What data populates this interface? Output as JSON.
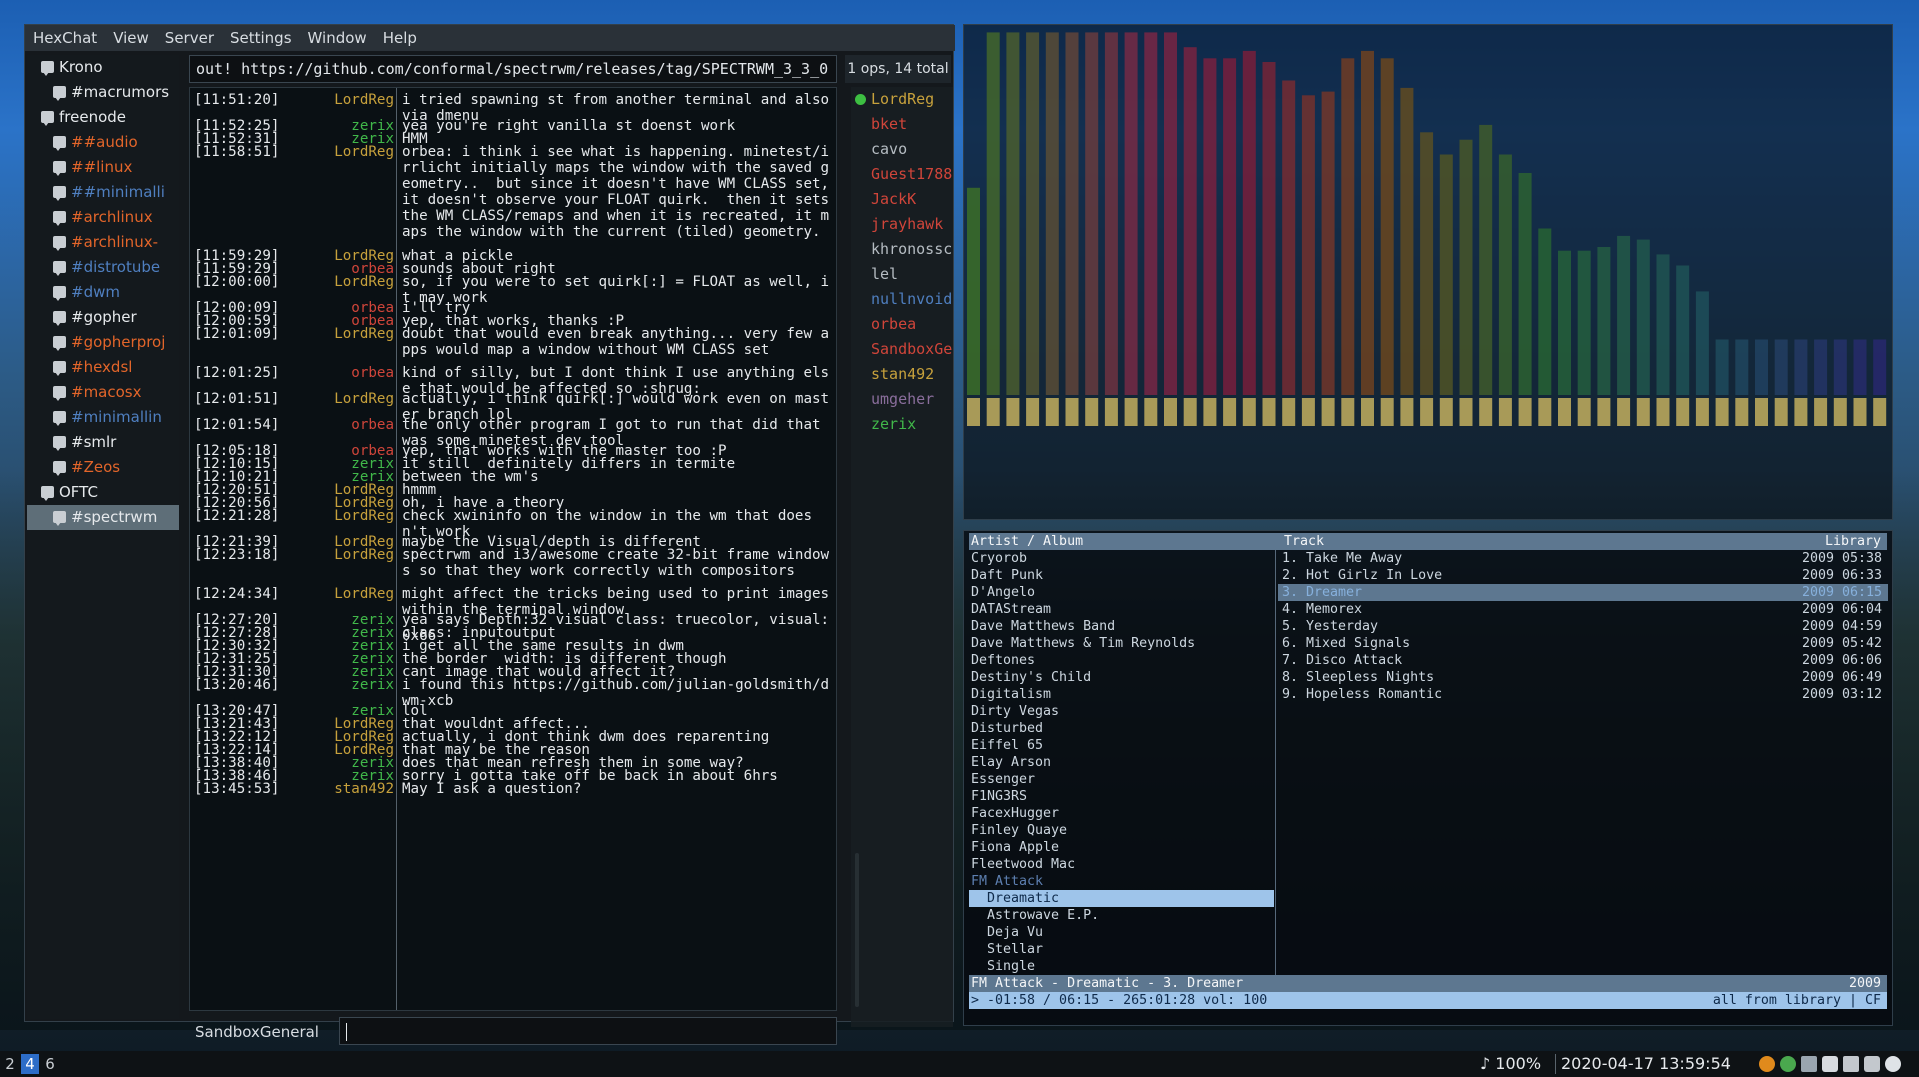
{
  "hexchat": {
    "menu": [
      "HexChat",
      "View",
      "Server",
      "Settings",
      "Window",
      "Help"
    ],
    "tree": [
      {
        "label": "Krono",
        "kind": "server",
        "color": "#e6e9ec"
      },
      {
        "label": "#macrumors",
        "kind": "channel",
        "color": "#e6e9ec"
      },
      {
        "label": "freenode",
        "kind": "server",
        "color": "#e6e9ec"
      },
      {
        "label": "##audio",
        "kind": "channel",
        "color": "#e2652a"
      },
      {
        "label": "##linux",
        "kind": "channel",
        "color": "#e2652a"
      },
      {
        "label": "##minimalli",
        "kind": "channel",
        "color": "#4f7fc0"
      },
      {
        "label": "#archlinux",
        "kind": "channel",
        "color": "#e2652a"
      },
      {
        "label": "#archlinux-",
        "kind": "channel",
        "color": "#e2652a"
      },
      {
        "label": "#distrotube",
        "kind": "channel",
        "color": "#4f7fc0"
      },
      {
        "label": "#dwm",
        "kind": "channel",
        "color": "#4f7fc0"
      },
      {
        "label": "#gopher",
        "kind": "channel",
        "color": "#e6e9ec"
      },
      {
        "label": "#gopherproj",
        "kind": "channel",
        "color": "#e2652a"
      },
      {
        "label": "#hexdsl",
        "kind": "channel",
        "color": "#e2652a"
      },
      {
        "label": "#macosx",
        "kind": "channel",
        "color": "#e2652a"
      },
      {
        "label": "#minimallin",
        "kind": "channel",
        "color": "#4f7fc0"
      },
      {
        "label": "#smlr",
        "kind": "channel",
        "color": "#e6e9ec"
      },
      {
        "label": "#Zeos",
        "kind": "channel",
        "color": "#e2652a"
      },
      {
        "label": "OFTC",
        "kind": "server",
        "color": "#e6e9ec"
      },
      {
        "label": "#spectrwm",
        "kind": "channel",
        "color": "#e6e9ec",
        "selected": true
      }
    ],
    "topic": "out! https://github.com/conformal/spectrwm/releases/tag/SPECTRWM_3_3_0",
    "user_count": "1 ops, 14 total",
    "messages": [
      {
        "ts": "[11:51:20]",
        "nick": "LordReg",
        "text": "i tried spawning st from another terminal and also via dmenu"
      },
      {
        "ts": "[11:52:25]",
        "nick": "zerix",
        "text": "yea you're right vanilla st doenst work"
      },
      {
        "ts": "[11:52:31]",
        "nick": "zerix",
        "text": "HMM"
      },
      {
        "ts": "[11:58:51]",
        "nick": "LordReg",
        "text": "orbea: i think i see what is happening. minetest/irrlicht initially maps the window with the saved geometry..  but since it doesn't have WM CLASS set, it doesn't observe your FLOAT quirk.  then it sets the WM CLASS/remaps and when it is recreated, it maps the window with the current (tiled) geometry."
      },
      {
        "ts": "[11:59:29]",
        "nick": "LordReg",
        "text": "what a pickle"
      },
      {
        "ts": "[11:59:29]",
        "nick": "orbea",
        "text": "sounds about right"
      },
      {
        "ts": "[12:00:00]",
        "nick": "LordReg",
        "text": "so, if you were to set quirk[:] = FLOAT as well, it may work"
      },
      {
        "ts": "[12:00:09]",
        "nick": "orbea",
        "text": "i'll try"
      },
      {
        "ts": "[12:00:59]",
        "nick": "orbea",
        "text": "yep, that works, thanks :P"
      },
      {
        "ts": "[12:01:09]",
        "nick": "LordReg",
        "text": "doubt that would even break anything... very few apps would map a window without WM CLASS set"
      },
      {
        "ts": "[12:01:25]",
        "nick": "orbea",
        "text": "kind of silly, but I dont think I use anything else that would be affected so :shrug:"
      },
      {
        "ts": "[12:01:51]",
        "nick": "LordReg",
        "text": "actually, i think quirk[:] would work even on master branch lol"
      },
      {
        "ts": "[12:01:54]",
        "nick": "orbea",
        "text": "the only other program I got to run that did that was some minetest dev tool"
      },
      {
        "ts": "[12:05:18]",
        "nick": "orbea",
        "text": "yep, that works with the master too :P"
      },
      {
        "ts": "[12:10:15]",
        "nick": "zerix",
        "text": "it still  definitely differs in termite"
      },
      {
        "ts": "[12:10:21]",
        "nick": "zerix",
        "text": "between the wm's"
      },
      {
        "ts": "[12:20:51]",
        "nick": "LordReg",
        "text": "hmmm"
      },
      {
        "ts": "[12:20:56]",
        "nick": "LordReg",
        "text": "oh, i have a theory"
      },
      {
        "ts": "[12:21:28]",
        "nick": "LordReg",
        "text": "check xwininfo on the window in the wm that doesn't work"
      },
      {
        "ts": "[12:21:39]",
        "nick": "LordReg",
        "text": "maybe the Visual/depth is different"
      },
      {
        "ts": "[12:23:18]",
        "nick": "LordReg",
        "text": "spectrwm and i3/awesome create 32-bit frame windows so that they work correctly with compositors"
      },
      {
        "ts": "[12:24:34]",
        "nick": "LordReg",
        "text": "might affect the tricks being used to print images within the terminal window"
      },
      {
        "ts": "[12:27:20]",
        "nick": "zerix",
        "text": "yea says Depth:32 visual class: truecolor, visual: 0x66"
      },
      {
        "ts": "[12:27:28]",
        "nick": "zerix",
        "text": "class: inputoutput"
      },
      {
        "ts": "[12:30:32]",
        "nick": "zerix",
        "text": "i get all the same results in dwm"
      },
      {
        "ts": "[12:31:25]",
        "nick": "zerix",
        "text": "the border  width: is different though"
      },
      {
        "ts": "[12:31:30]",
        "nick": "zerix",
        "text": "cant image that would affect it?"
      },
      {
        "ts": "[13:20:46]",
        "nick": "zerix",
        "text": "i found this https://github.com/julian-goldsmith/dwm-xcb"
      },
      {
        "ts": "[13:20:47]",
        "nick": "zerix",
        "text": "lol"
      },
      {
        "ts": "[13:21:43]",
        "nick": "LordReg",
        "text": "that wouldnt affect..."
      },
      {
        "ts": "[13:22:12]",
        "nick": "LordReg",
        "text": "actually, i dont think dwm does reparenting"
      },
      {
        "ts": "[13:22:14]",
        "nick": "LordReg",
        "text": "that may be the reason"
      },
      {
        "ts": "[13:38:40]",
        "nick": "zerix",
        "text": "does that mean refresh them in some way?"
      },
      {
        "ts": "[13:38:46]",
        "nick": "zerix",
        "text": "sorry i gotta take off be back in about 6hrs"
      },
      {
        "ts": "[13:45:53]",
        "nick": "stan492",
        "text": "May I ask a question?"
      }
    ],
    "message_lines": [
      0,
      2,
      3,
      4,
      12,
      13,
      14,
      16,
      17,
      18,
      21,
      23,
      25,
      27,
      28,
      29,
      30,
      31,
      32,
      34,
      35,
      38,
      40,
      41,
      42,
      43,
      44,
      45,
      47,
      48,
      49,
      50,
      51,
      52,
      53
    ],
    "nick_colors": {
      "LordReg": "#c7a13c",
      "zerix": "#41b84a",
      "orbea": "#d0453a",
      "stan492": "#c7a13c"
    },
    "users": [
      {
        "nick": "LordReg",
        "color": "#c7a13c",
        "op": true
      },
      {
        "nick": "bket",
        "color": "#d0453a"
      },
      {
        "nick": "cavo",
        "color": "#b5bcc2"
      },
      {
        "nick": "Guest1788",
        "color": "#d0453a"
      },
      {
        "nick": "JackK",
        "color": "#d0453a"
      },
      {
        "nick": "jrayhawk",
        "color": "#d0453a"
      },
      {
        "nick": "khronosschoty",
        "color": "#b5bcc2"
      },
      {
        "nick": "lel",
        "color": "#b5bcc2"
      },
      {
        "nick": "nullnvoid",
        "color": "#4f7fc0"
      },
      {
        "nick": "orbea",
        "color": "#d0453a"
      },
      {
        "nick": "SandboxGe",
        "color": "#d0453a"
      },
      {
        "nick": "stan492",
        "color": "#c7a13c"
      },
      {
        "nick": "umgeher",
        "color": "#8a6e9c"
      },
      {
        "nick": "zerix",
        "color": "#41b84a"
      }
    ],
    "input_nick": "SandboxGeneral",
    "input_value": ""
  },
  "visualizer": {
    "bar_levels": [
      0.56,
      0.98,
      0.98,
      0.98,
      0.98,
      0.98,
      0.98,
      0.98,
      0.98,
      0.98,
      0.98,
      0.94,
      0.91,
      0.91,
      0.93,
      0.9,
      0.85,
      0.81,
      0.82,
      0.91,
      0.93,
      0.91,
      0.83,
      0.71,
      0.65,
      0.69,
      0.73,
      0.65,
      0.6,
      0.45,
      0.39,
      0.39,
      0.4,
      0.43,
      0.42,
      0.38,
      0.35,
      0.28,
      0.15,
      0.15,
      0.15,
      0.15,
      0.15,
      0.15,
      0.15,
      0.15,
      0.15
    ],
    "peak_color": "#a89a58"
  },
  "cmus": {
    "header_left": "Artist / Album",
    "header_mid": "Track",
    "header_right": "Library",
    "artists": [
      {
        "name": "Cryorob"
      },
      {
        "name": "Daft Punk"
      },
      {
        "name": "D'Angelo"
      },
      {
        "name": "DATAStream"
      },
      {
        "name": "Dave Matthews Band"
      },
      {
        "name": "Dave Matthews & Tim Reynolds"
      },
      {
        "name": "Deftones"
      },
      {
        "name": "Destiny's Child"
      },
      {
        "name": "Digitalism"
      },
      {
        "name": "Dirty Vegas"
      },
      {
        "name": "Disturbed"
      },
      {
        "name": "Eiffel 65"
      },
      {
        "name": "Elay Arson"
      },
      {
        "name": "Essenger"
      },
      {
        "name": "F1NG3RS"
      },
      {
        "name": "FacexHugger"
      },
      {
        "name": "Finley Quaye"
      },
      {
        "name": "Fiona Apple"
      },
      {
        "name": "Fleetwood Mac"
      },
      {
        "name": "FM Attack",
        "state": "playing"
      },
      {
        "name": "  Dreamatic",
        "state": "selected"
      },
      {
        "name": "  Astrowave E.P."
      },
      {
        "name": "  Deja Vu"
      },
      {
        "name": "  Stellar"
      },
      {
        "name": "  Single"
      }
    ],
    "tracks": [
      {
        "title": "1. Take Me Away",
        "info": "2009 05:38"
      },
      {
        "title": "2. Hot Girlz In Love",
        "info": "2009 06:33"
      },
      {
        "title": "3. Dreamer",
        "info": "2009 06:15",
        "state": "current"
      },
      {
        "title": "4. Memorex",
        "info": "2009 06:04"
      },
      {
        "title": "5. Yesterday",
        "info": "2009 04:59"
      },
      {
        "title": "6. Mixed Signals",
        "info": "2009 05:42"
      },
      {
        "title": "7. Disco Attack",
        "info": "2009 06:06"
      },
      {
        "title": "8. Sleepless Nights",
        "info": "2009 06:49"
      },
      {
        "title": "9. Hopeless Romantic",
        "info": "2009 03:12"
      }
    ],
    "status_left": "FM Attack - Dreamatic -  3. Dreamer",
    "status_right": "2009",
    "bar_left": "> -01:58 / 06:15 - 265:01:28 vol: 100",
    "bar_right": "all from library | CF"
  },
  "panel": {
    "workspaces": [
      {
        "label": "2"
      },
      {
        "label": "4",
        "active": true
      },
      {
        "label": "6"
      }
    ],
    "volume": "♪ 100%",
    "datetime": "2020-04-17  13:59:54"
  }
}
